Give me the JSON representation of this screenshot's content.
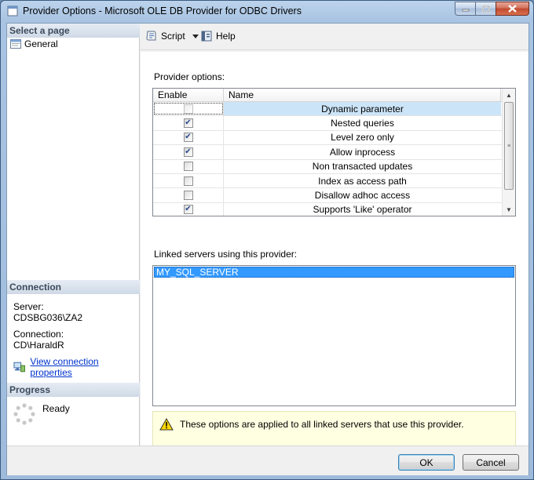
{
  "window": {
    "title": "Provider Options - Microsoft OLE DB Provider for ODBC Drivers"
  },
  "sidebar": {
    "select_page_header": "Select a page",
    "pages": [
      {
        "label": "General"
      }
    ],
    "connection_header": "Connection",
    "server_label": "Server:",
    "server_value": "CDSBG036\\ZA2",
    "connection_label": "Connection:",
    "connection_value": "CD\\HaraldR",
    "view_connection_link": "View connection properties",
    "progress_header": "Progress",
    "progress_status": "Ready"
  },
  "toolbar": {
    "script_label": "Script",
    "help_label": "Help"
  },
  "provider_options": {
    "label": "Provider options:",
    "columns": [
      "Enable",
      "Name"
    ],
    "rows": [
      {
        "name": "Dynamic parameter",
        "enabled": false
      },
      {
        "name": "Nested queries",
        "enabled": true
      },
      {
        "name": "Level zero only",
        "enabled": true
      },
      {
        "name": "Allow inprocess",
        "enabled": true
      },
      {
        "name": "Non transacted updates",
        "enabled": false
      },
      {
        "name": "Index as access path",
        "enabled": false
      },
      {
        "name": "Disallow adhoc access",
        "enabled": false
      },
      {
        "name": "Supports 'Like' operator",
        "enabled": true
      }
    ]
  },
  "linked_servers": {
    "label": "Linked servers using this provider:",
    "items": [
      "MY_SQL_SERVER"
    ]
  },
  "info": {
    "message": "These options are applied to all linked servers that use this provider."
  },
  "buttons": {
    "ok_label": "OK",
    "cancel_label": "Cancel"
  },
  "colors": {
    "selection": "#3399ff",
    "info_background": "#ffffe1",
    "link": "#0033cc"
  }
}
